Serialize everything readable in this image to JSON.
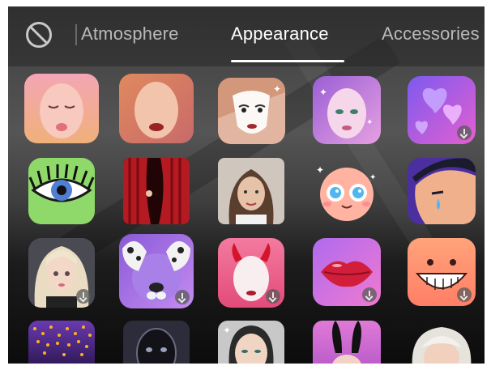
{
  "tabs": {
    "no_effect_icon": "no-effect-icon",
    "items": [
      {
        "label": "Atmosphere",
        "active": false
      },
      {
        "label": "Appearance",
        "active": true
      },
      {
        "label": "Accessories",
        "active": false
      }
    ]
  },
  "effects": [
    {
      "icon": "kiss-face-icon"
    },
    {
      "icon": "red-lips-face-icon"
    },
    {
      "icon": "white-mask-icon"
    },
    {
      "icon": "sparkle-makeup-face-icon"
    },
    {
      "icon": "purple-hearts-icon",
      "downloadable": true
    },
    {
      "icon": "lashes-eye-icon"
    },
    {
      "icon": "red-curtain-icon"
    },
    {
      "icon": "portrait-photo-icon"
    },
    {
      "icon": "sparkle-eyes-face-icon"
    },
    {
      "icon": "crying-face-icon"
    },
    {
      "icon": "blonde-avatar-icon",
      "downloadable": true
    },
    {
      "icon": "dalmatian-dog-icon",
      "downloadable": true
    },
    {
      "icon": "devil-horns-face-icon",
      "downloadable": true
    },
    {
      "icon": "glossy-lips-icon",
      "downloadable": true
    },
    {
      "icon": "big-smile-face-icon",
      "downloadable": true
    },
    {
      "icon": "gold-glitter-icon"
    },
    {
      "icon": "dark-face-icon"
    },
    {
      "icon": "sparkle-face-icon"
    },
    {
      "icon": "bunny-ears-icon"
    },
    {
      "icon": "white-hair-face-icon"
    }
  ],
  "colors": {
    "active_tab": "#ffffff",
    "inactive_tab": "#b9b9b9"
  }
}
